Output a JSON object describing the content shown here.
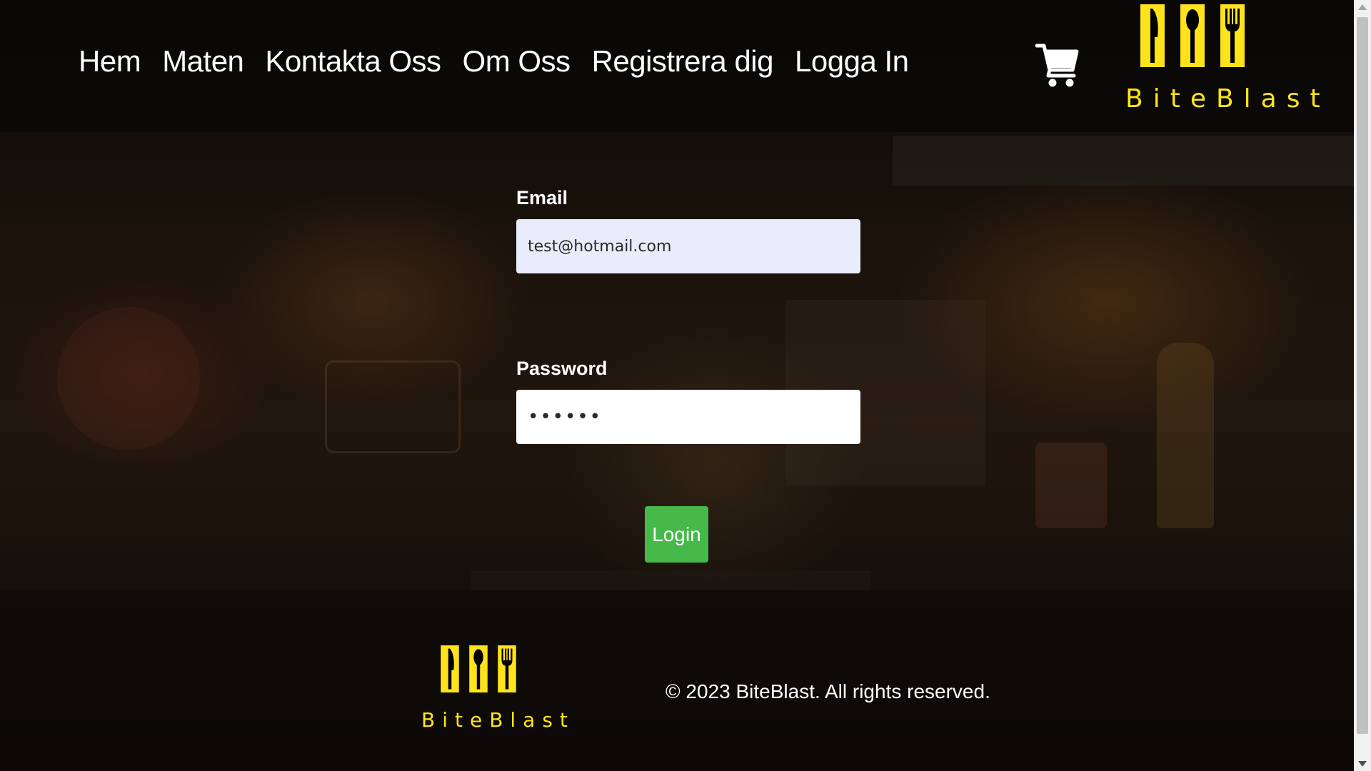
{
  "nav": {
    "items": [
      {
        "label": "Hem"
      },
      {
        "label": "Maten"
      },
      {
        "label": "Kontakta Oss"
      },
      {
        "label": "Om Oss"
      },
      {
        "label": "Registrera dig"
      },
      {
        "label": "Logga In"
      }
    ],
    "cart_icon": "shopping-cart-icon"
  },
  "brand": {
    "name": "BiteBlast",
    "color": "#ffe31a",
    "icons": [
      "knife-icon",
      "spoon-icon",
      "fork-icon"
    ]
  },
  "form": {
    "email_label": "Email",
    "email_value": "test@hotmail.com",
    "password_label": "Password",
    "password_value": "••••••",
    "login_label": "Login",
    "login_color": "#46b94a"
  },
  "footer": {
    "copyright": "© 2023 BiteBlast. All rights reserved."
  }
}
